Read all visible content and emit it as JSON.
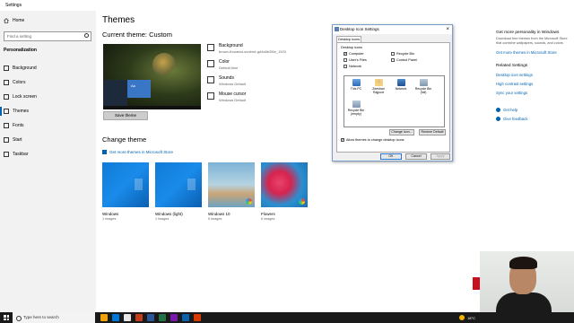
{
  "window": {
    "title": "Settings"
  },
  "sidebar": {
    "home": "Home",
    "search_placeholder": "Find a setting",
    "section": "Personalization",
    "items": [
      {
        "label": "Background",
        "icon": "picture-icon"
      },
      {
        "label": "Colors",
        "icon": "palette-icon"
      },
      {
        "label": "Lock screen",
        "icon": "monitor-icon"
      },
      {
        "label": "Themes",
        "icon": "brush-icon",
        "active": true
      },
      {
        "label": "Fonts",
        "icon": "font-icon"
      },
      {
        "label": "Start",
        "icon": "start-icon"
      },
      {
        "label": "Taskbar",
        "icon": "taskbar-icon"
      }
    ]
  },
  "main": {
    "title": "Themes",
    "current_theme": "Current theme: Custom",
    "preview_tile": "Aa",
    "props": [
      {
        "title": "Background",
        "value": "brown-throated-sunbird-gd4a6b2f6e_1920"
      },
      {
        "title": "Color",
        "value": "Default blue"
      },
      {
        "title": "Sounds",
        "value": "Windows Default"
      },
      {
        "title": "Mouse cursor",
        "value": "Windows Default"
      }
    ],
    "save_button": "Save theme",
    "change_theme": "Change theme",
    "store_link": "Get more themes in Microsoft Store",
    "themes": [
      {
        "name": "Windows",
        "count": "1 images",
        "style": "blue"
      },
      {
        "name": "Windows (light)",
        "count": "1 images",
        "style": "blue"
      },
      {
        "name": "Windows 10",
        "count": "5 images",
        "style": "beach"
      },
      {
        "name": "Flowers",
        "count": "6 images",
        "style": "flower"
      }
    ]
  },
  "dialog": {
    "title": "Desktop Icon Settings",
    "tab": "Desktop Icons",
    "group_label": "Desktop icons",
    "checkboxes": [
      {
        "label": "Computer",
        "checked": true
      },
      {
        "label": "Recycle Bin",
        "checked": false
      },
      {
        "label": "User's Files",
        "checked": false
      },
      {
        "label": "Control Panel",
        "checked": false
      },
      {
        "label": "Network",
        "checked": false
      }
    ],
    "icons": [
      {
        "label": "This PC",
        "style": "pc"
      },
      {
        "label": "Zeeshan Rajpoot",
        "style": "user"
      },
      {
        "label": "Network",
        "style": "net"
      },
      {
        "label": "Recycle Bin (full)",
        "style": "bin"
      },
      {
        "label": "Recycle Bin (empty)",
        "style": "bin"
      }
    ],
    "change_icon": "Change Icon...",
    "restore_default": "Restore Default",
    "allow_themes": "Allow themes to change desktop icons",
    "ok": "OK",
    "cancel": "Cancel",
    "apply": "Apply"
  },
  "right_pane": {
    "heading": "Get more personality in Windows",
    "text": "Download free themes from the Microsoft Store that combine wallpapers, sounds, and colors",
    "store_link": "Get more themes in Microsoft Store",
    "related_heading": "Related Settings",
    "related": [
      "Desktop icon settings",
      "High contrast settings",
      "Sync your settings"
    ],
    "help": "Get help",
    "feedback": "Give feedback"
  },
  "taskbar": {
    "search": "Type here to search",
    "weather": "18°C",
    "apps": [
      "#f0a30a",
      "#0078d7",
      "#e8e8e8",
      "#c43e1c",
      "#2b579a",
      "#217346",
      "#7719aa",
      "#0a64ad",
      "#d83b01"
    ]
  }
}
